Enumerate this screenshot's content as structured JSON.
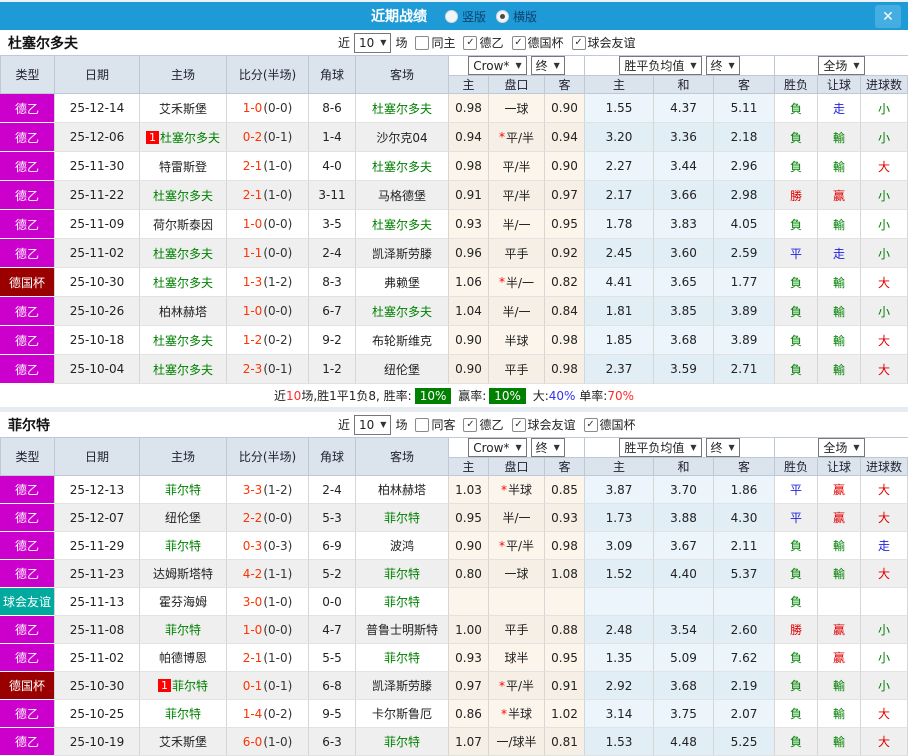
{
  "colors": {
    "titlebar_bg": "#1E9BD7",
    "close_bg": "#45AEE0",
    "team_green": "#008000",
    "score_red": "#FF3300",
    "league": {
      "德乙": "#CC00CC",
      "德国杯": "#9A0000",
      "球会友谊": "#00A99D"
    },
    "value": {
      "負": "#008000",
      "勝": "#E00000",
      "平": "#2222DD",
      "輸": "#008000",
      "赢": "#E00000",
      "走": "#2222DD",
      "小": "#008000",
      "大": "#E00000"
    }
  },
  "titlebar": {
    "title": "近期战绩",
    "radios": [
      {
        "label": "竖版",
        "selected": false
      },
      {
        "label": "横版",
        "selected": true
      }
    ],
    "close_icon": "✕"
  },
  "header": {
    "left_cols": [
      "类型",
      "日期",
      "主场",
      "比分(半场)",
      "角球",
      "客场"
    ],
    "dropdowns": {
      "company": "Crow*",
      "final1": "终",
      "avg": "胜平负均值",
      "final2": "终",
      "scope": "全场"
    },
    "arrow_icon": "▼",
    "sub_cols": [
      "主",
      "盘口",
      "客",
      "主",
      "和",
      "客",
      "胜负",
      "让球",
      "进球数"
    ]
  },
  "teams": [
    {
      "name": "杜塞尔多夫",
      "filter": {
        "near_label": "近",
        "count": "10",
        "matches_label": "场",
        "checkboxes": [
          {
            "label": "同主",
            "checked": false
          },
          {
            "label": "德乙",
            "checked": true
          },
          {
            "label": "德国杯",
            "checked": true
          },
          {
            "label": "球会友谊",
            "checked": true
          }
        ]
      },
      "rows": [
        {
          "lg": "德乙",
          "date": "25-12-14",
          "home": "艾禾斯堡",
          "hg": false,
          "hcard": false,
          "score": "1-0",
          "half": "(0-0)",
          "cor": "8-6",
          "away": "杜塞尔多夫",
          "ag": true,
          "acard": false,
          "o1": "0.98",
          "line": "一球",
          "star": false,
          "o2": "0.90",
          "m1": "1.55",
          "m2": "4.37",
          "m3": "5.11",
          "res": "負",
          "hr": "走",
          "gl": "小"
        },
        {
          "lg": "德乙",
          "date": "25-12-06",
          "home": "杜塞尔多夫",
          "hg": true,
          "hcard": true,
          "score": "0-2",
          "half": "(0-1)",
          "cor": "1-4",
          "away": "沙尔克04",
          "ag": false,
          "acard": false,
          "o1": "0.94",
          "line": "平/半",
          "star": true,
          "o2": "0.94",
          "m1": "3.20",
          "m2": "3.36",
          "m3": "2.18",
          "res": "負",
          "hr": "輸",
          "gl": "小"
        },
        {
          "lg": "德乙",
          "date": "25-11-30",
          "home": "特雷斯登",
          "hg": false,
          "hcard": false,
          "score": "2-1",
          "half": "(1-0)",
          "cor": "4-0",
          "away": "杜塞尔多夫",
          "ag": true,
          "acard": false,
          "o1": "0.98",
          "line": "平/半",
          "star": false,
          "o2": "0.90",
          "m1": "2.27",
          "m2": "3.44",
          "m3": "2.96",
          "res": "負",
          "hr": "輸",
          "gl": "大"
        },
        {
          "lg": "德乙",
          "date": "25-11-22",
          "home": "杜塞尔多夫",
          "hg": true,
          "hcard": false,
          "score": "2-1",
          "half": "(1-0)",
          "cor": "3-11",
          "away": "马格德堡",
          "ag": false,
          "acard": false,
          "o1": "0.91",
          "line": "平/半",
          "star": false,
          "o2": "0.97",
          "m1": "2.17",
          "m2": "3.66",
          "m3": "2.98",
          "res": "勝",
          "hr": "赢",
          "gl": "小"
        },
        {
          "lg": "德乙",
          "date": "25-11-09",
          "home": "荷尔斯泰因",
          "hg": false,
          "hcard": false,
          "score": "1-0",
          "half": "(0-0)",
          "cor": "3-5",
          "away": "杜塞尔多夫",
          "ag": true,
          "acard": false,
          "o1": "0.93",
          "line": "半/一",
          "star": false,
          "o2": "0.95",
          "m1": "1.78",
          "m2": "3.83",
          "m3": "4.05",
          "res": "負",
          "hr": "輸",
          "gl": "小"
        },
        {
          "lg": "德乙",
          "date": "25-11-02",
          "home": "杜塞尔多夫",
          "hg": true,
          "hcard": false,
          "score": "1-1",
          "half": "(0-0)",
          "cor": "2-4",
          "away": "凯泽斯劳滕",
          "ag": false,
          "acard": false,
          "o1": "0.96",
          "line": "平手",
          "star": false,
          "o2": "0.92",
          "m1": "2.45",
          "m2": "3.60",
          "m3": "2.59",
          "res": "平",
          "hr": "走",
          "gl": "小"
        },
        {
          "lg": "德国杯",
          "date": "25-10-30",
          "home": "杜塞尔多夫",
          "hg": true,
          "hcard": false,
          "score": "1-3",
          "half": "(1-2)",
          "cor": "8-3",
          "away": "弗赖堡",
          "ag": false,
          "acard": false,
          "o1": "1.06",
          "line": "半/一",
          "star": true,
          "o2": "0.82",
          "m1": "4.41",
          "m2": "3.65",
          "m3": "1.77",
          "res": "負",
          "hr": "輸",
          "gl": "大"
        },
        {
          "lg": "德乙",
          "date": "25-10-26",
          "home": "柏林赫塔",
          "hg": false,
          "hcard": false,
          "score": "1-0",
          "half": "(0-0)",
          "cor": "6-7",
          "away": "杜塞尔多夫",
          "ag": true,
          "acard": false,
          "o1": "1.04",
          "line": "半/一",
          "star": false,
          "o2": "0.84",
          "m1": "1.81",
          "m2": "3.85",
          "m3": "3.89",
          "res": "負",
          "hr": "輸",
          "gl": "小"
        },
        {
          "lg": "德乙",
          "date": "25-10-18",
          "home": "杜塞尔多夫",
          "hg": true,
          "hcard": false,
          "score": "1-2",
          "half": "(0-2)",
          "cor": "9-2",
          "away": "布轮斯维克",
          "ag": false,
          "acard": false,
          "o1": "0.90",
          "line": "半球",
          "star": false,
          "o2": "0.98",
          "m1": "1.85",
          "m2": "3.68",
          "m3": "3.89",
          "res": "負",
          "hr": "輸",
          "gl": "大"
        },
        {
          "lg": "德乙",
          "date": "25-10-04",
          "home": "杜塞尔多夫",
          "hg": true,
          "hcard": false,
          "score": "2-3",
          "half": "(0-1)",
          "cor": "1-2",
          "away": "纽伦堡",
          "ag": false,
          "acard": false,
          "o1": "0.90",
          "line": "平手",
          "star": false,
          "o2": "0.98",
          "m1": "2.37",
          "m2": "3.59",
          "m3": "2.71",
          "res": "負",
          "hr": "輸",
          "gl": "大"
        }
      ],
      "summary": {
        "segments": [
          {
            "t": "近",
            "c": "k"
          },
          {
            "t": "10",
            "c": "r"
          },
          {
            "t": "场,胜1平1负8, 胜率:",
            "c": "k"
          },
          {
            "t": "10%",
            "c": "badge"
          },
          {
            "t": " 赢率:",
            "c": "k"
          },
          {
            "t": "10%",
            "c": "badge"
          },
          {
            "t": " 大:",
            "c": "k"
          },
          {
            "t": "40%",
            "c": "b"
          },
          {
            "t": " 单率:",
            "c": "k"
          },
          {
            "t": "70%",
            "c": "r"
          }
        ]
      }
    },
    {
      "name": "菲尔特",
      "filter": {
        "near_label": "近",
        "count": "10",
        "matches_label": "场",
        "checkboxes": [
          {
            "label": "同客",
            "checked": false
          },
          {
            "label": "德乙",
            "checked": true
          },
          {
            "label": "球会友谊",
            "checked": true
          },
          {
            "label": "德国杯",
            "checked": true
          }
        ]
      },
      "rows": [
        {
          "lg": "德乙",
          "date": "25-12-13",
          "home": "菲尔特",
          "hg": true,
          "hcard": false,
          "score": "3-3",
          "half": "(1-2)",
          "cor": "2-4",
          "away": "柏林赫塔",
          "ag": false,
          "acard": false,
          "o1": "1.03",
          "line": "半球",
          "star": true,
          "o2": "0.85",
          "m1": "3.87",
          "m2": "3.70",
          "m3": "1.86",
          "res": "平",
          "hr": "赢",
          "gl": "大"
        },
        {
          "lg": "德乙",
          "date": "25-12-07",
          "home": "纽伦堡",
          "hg": false,
          "hcard": false,
          "score": "2-2",
          "half": "(0-0)",
          "cor": "5-3",
          "away": "菲尔特",
          "ag": true,
          "acard": false,
          "o1": "0.95",
          "line": "半/一",
          "star": false,
          "o2": "0.93",
          "m1": "1.73",
          "m2": "3.88",
          "m3": "4.30",
          "res": "平",
          "hr": "赢",
          "gl": "大"
        },
        {
          "lg": "德乙",
          "date": "25-11-29",
          "home": "菲尔特",
          "hg": true,
          "hcard": false,
          "score": "0-3",
          "half": "(0-3)",
          "cor": "6-9",
          "away": "波鸿",
          "ag": false,
          "acard": false,
          "o1": "0.90",
          "line": "平/半",
          "star": true,
          "o2": "0.98",
          "m1": "3.09",
          "m2": "3.67",
          "m3": "2.11",
          "res": "負",
          "hr": "輸",
          "gl": "走"
        },
        {
          "lg": "德乙",
          "date": "25-11-23",
          "home": "达姆斯塔特",
          "hg": false,
          "hcard": false,
          "score": "4-2",
          "half": "(1-1)",
          "cor": "5-2",
          "away": "菲尔特",
          "ag": true,
          "acard": false,
          "o1": "0.80",
          "line": "一球",
          "star": false,
          "o2": "1.08",
          "m1": "1.52",
          "m2": "4.40",
          "m3": "5.37",
          "res": "負",
          "hr": "輸",
          "gl": "大"
        },
        {
          "lg": "球会友谊",
          "date": "25-11-13",
          "home": "霍芬海姆",
          "hg": false,
          "hcard": false,
          "score": "3-0",
          "half": "(1-0)",
          "cor": "0-0",
          "away": "菲尔特",
          "ag": true,
          "acard": false,
          "o1": "",
          "line": "",
          "star": false,
          "o2": "",
          "m1": "",
          "m2": "",
          "m3": "",
          "res": "負",
          "hr": "",
          "gl": ""
        },
        {
          "lg": "德乙",
          "date": "25-11-08",
          "home": "菲尔特",
          "hg": true,
          "hcard": false,
          "score": "1-0",
          "half": "(0-0)",
          "cor": "4-7",
          "away": "普鲁士明斯特",
          "ag": false,
          "acard": false,
          "o1": "1.00",
          "line": "平手",
          "star": false,
          "o2": "0.88",
          "m1": "2.48",
          "m2": "3.54",
          "m3": "2.60",
          "res": "勝",
          "hr": "赢",
          "gl": "小"
        },
        {
          "lg": "德乙",
          "date": "25-11-02",
          "home": "帕德博恩",
          "hg": false,
          "hcard": false,
          "score": "2-1",
          "half": "(1-0)",
          "cor": "5-5",
          "away": "菲尔特",
          "ag": true,
          "acard": false,
          "o1": "0.93",
          "line": "球半",
          "star": false,
          "o2": "0.95",
          "m1": "1.35",
          "m2": "5.09",
          "m3": "7.62",
          "res": "負",
          "hr": "赢",
          "gl": "小"
        },
        {
          "lg": "德国杯",
          "date": "25-10-30",
          "home": "菲尔特",
          "hg": true,
          "hcard": true,
          "score": "0-1",
          "half": "(0-1)",
          "cor": "6-8",
          "away": "凯泽斯劳滕",
          "ag": false,
          "acard": false,
          "o1": "0.97",
          "line": "平/半",
          "star": true,
          "o2": "0.91",
          "m1": "2.92",
          "m2": "3.68",
          "m3": "2.19",
          "res": "負",
          "hr": "輸",
          "gl": "小"
        },
        {
          "lg": "德乙",
          "date": "25-10-25",
          "home": "菲尔特",
          "hg": true,
          "hcard": false,
          "score": "1-4",
          "half": "(0-2)",
          "cor": "9-5",
          "away": "卡尔斯鲁厄",
          "ag": false,
          "acard": false,
          "o1": "0.86",
          "line": "半球",
          "star": true,
          "o2": "1.02",
          "m1": "3.14",
          "m2": "3.75",
          "m3": "2.07",
          "res": "負",
          "hr": "輸",
          "gl": "大"
        },
        {
          "lg": "德乙",
          "date": "25-10-19",
          "home": "艾禾斯堡",
          "hg": false,
          "hcard": false,
          "score": "6-0",
          "half": "(1-0)",
          "cor": "6-3",
          "away": "菲尔特",
          "ag": true,
          "acard": false,
          "o1": "1.07",
          "line": "一/球半",
          "star": false,
          "o2": "0.81",
          "m1": "1.53",
          "m2": "4.48",
          "m3": "5.25",
          "res": "負",
          "hr": "輸",
          "gl": "大"
        }
      ]
    }
  ]
}
